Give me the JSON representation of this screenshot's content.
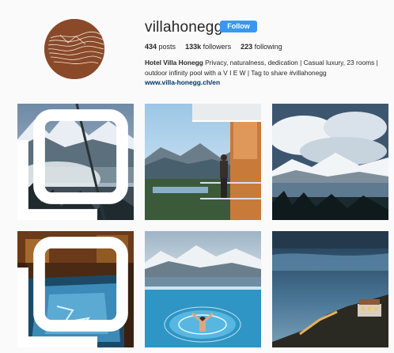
{
  "profile": {
    "username": "villahonegg",
    "follow_label": "Follow",
    "stats": {
      "posts_count": "434",
      "posts_label": "posts",
      "followers_count": "133k",
      "followers_label": "followers",
      "following_count": "223",
      "following_label": "following"
    },
    "bio": {
      "name": "Hotel Villa Honegg",
      "text": "Privacy, naturalness, dedication | Casual luxury, 23 rooms | outdoor infinity pool with a V I E W | Tag to share #villahonegg",
      "link": "www.villa-honegg.ch/en"
    }
  },
  "colors": {
    "follow_button": "#3897f0",
    "avatar_bg": "#8a4a2a"
  },
  "posts": [
    {
      "subject": "steaming outdoor pool with snowy mountains and lake",
      "multi": true
    },
    {
      "subject": "man on balcony looking over valley and lake",
      "multi": false
    },
    {
      "subject": "dramatic clouds over snowy mountain range and lake",
      "multi": false
    },
    {
      "subject": "illuminated indoor pool in wooden room",
      "multi": true
    },
    {
      "subject": "man floating in infinity pool facing lake and mountains",
      "multi": false
    },
    {
      "subject": "hotel building above sea of fog at sunrise",
      "multi": false
    }
  ]
}
